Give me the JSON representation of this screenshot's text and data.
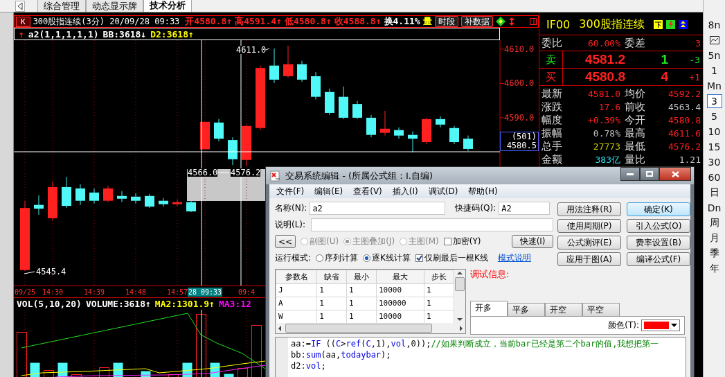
{
  "tabs": [
    {
      "label": "综合管理",
      "selected": false
    },
    {
      "label": "动态显示牌",
      "selected": false
    },
    {
      "label": "技术分析",
      "selected": true
    }
  ],
  "chart": {
    "period_button": "K",
    "title": "300股指连续(3分) 20/09/28 09:33",
    "quotes": [
      {
        "text": "开4580.8↑",
        "color": "#ff2020"
      },
      {
        "text": "高4591.4↑",
        "color": "#ff2020"
      },
      {
        "text": "低4580.8↑",
        "color": "#ff2020"
      },
      {
        "text": "收4588.8↑",
        "color": "#ff2020"
      },
      {
        "text": "换4.11%",
        "color": "#ffffff"
      },
      {
        "text": "量",
        "color": "#ffff00"
      }
    ],
    "buttons": [
      "时段",
      "补数据"
    ],
    "indicator": [
      {
        "text": "↑",
        "color": "#ff2020"
      },
      {
        "text": "a2(1,1,1,1,1)",
        "color": "#ffffff"
      },
      {
        "text": "BB:3618↓",
        "color": "#ffffff"
      },
      {
        "text": "D2:3618↑",
        "color": "#ffff00"
      }
    ],
    "time_axis_marks": [
      {
        "selected": false
      },
      {
        "selected": false
      },
      {
        "selected": false
      },
      {
        "selected": false
      },
      {
        "selected": false
      },
      {
        "selected": true
      },
      {
        "selected": false
      }
    ],
    "chart_data": {
      "type": "candlestick",
      "grid": true,
      "categories": [
        "09/25",
        null,
        "14:30",
        null,
        null,
        "14:39",
        null,
        null,
        "14:48",
        null,
        null,
        "14:57",
        null,
        "28 09:33",
        null,
        null,
        "09:4",
        null,
        null,
        null,
        null,
        null,
        null,
        null,
        null,
        null,
        null,
        null,
        null,
        null,
        null,
        null,
        null
      ],
      "ohlc": [
        [
          4545.6,
          4565.8,
          4545.4,
          4563.7
        ],
        [
          4564.6,
          4567.4,
          4561.7,
          4563.5
        ],
        [
          4560.7,
          4571.4,
          4560.1,
          4569.8
        ],
        [
          4569.8,
          4572.8,
          4563.7,
          4564.3
        ],
        [
          4569.4,
          4570.6,
          4564.6,
          4565.8
        ],
        [
          4568.2,
          4569.4,
          4565.0,
          4565.8
        ],
        [
          4565.8,
          4570.2,
          4565.4,
          4569.4
        ],
        [
          4567.2,
          4568.6,
          4565.4,
          4566.4
        ],
        [
          4567.0,
          4568.0,
          4565.0,
          4565.8
        ],
        [
          4567.2,
          4567.8,
          4563.7,
          4564.1
        ],
        [
          4565.8,
          4566.6,
          4564.1,
          4564.8
        ],
        [
          4564.8,
          4566.2,
          4564.3,
          4565.4
        ],
        [
          4565.4,
          4565.8,
          4562.5,
          4562.7
        ],
        [
          4580.8,
          4588.8,
          4580.8,
          4588.8
        ],
        [
          4588.6,
          4589.6,
          4583.1,
          4583.9
        ],
        [
          4583.5,
          4584.3,
          4576.2,
          4577.9
        ],
        [
          4577.7,
          4588.0,
          4575.9,
          4587.6
        ],
        [
          4587.0,
          4605.2,
          4586.4,
          4604.5
        ],
        [
          4605.2,
          4610.2,
          4600.1,
          4601.1
        ],
        [
          4602.1,
          4611.0,
          4601.7,
          4605.6
        ],
        [
          4605.6,
          4606.6,
          4600.5,
          4601.1
        ],
        [
          4602.1,
          4603.3,
          4595.3,
          4596.1
        ],
        [
          4597.5,
          4598.5,
          4590.8,
          4591.4
        ],
        [
          4596.1,
          4599.1,
          4589.6,
          4590.0
        ],
        [
          4594.0,
          4594.9,
          4589.6,
          4590.0
        ],
        [
          4590.0,
          4590.8,
          4584.3,
          4585.0
        ],
        [
          4585.6,
          4592.0,
          4584.8,
          4586.8
        ],
        [
          4586.4,
          4587.2,
          4583.9,
          4584.8
        ],
        [
          4585.0,
          4586.0,
          4579.9,
          4583.9
        ],
        [
          4582.9,
          4590.0,
          4582.3,
          4589.6
        ],
        [
          4589.6,
          4590.4,
          4587.2,
          4588.0
        ],
        [
          4587.0,
          4587.6,
          4582.3,
          4582.9
        ],
        [
          4583.9,
          4584.8,
          4580.3,
          4580.9
        ]
      ],
      "ylim": [
        4541.1,
        4612.6
      ],
      "yticks": [
        {
          "value": 4590,
          "label": "4590.0"
        },
        {
          "value": 4600,
          "label": "4600.0"
        },
        {
          "value": 4610,
          "label": "4610.0"
        }
      ]
    },
    "cursor_price": {
      "count": "(501)",
      "price": "4580.5"
    },
    "annotations": [
      "4611.0",
      "4566.0",
      "4576.2",
      "4545.4"
    ],
    "volume_legend": [
      {
        "text": "VOL(5,10,20)",
        "color": "#ffffff"
      },
      {
        "text": "VOLUME:3618↑",
        "color": "#ffffff"
      },
      {
        "text": "MA2:1301.9↑",
        "color": "#ffff00"
      },
      {
        "text": "MA3:12",
        "color": "#ff00ff"
      }
    ]
  },
  "quote": {
    "code": "IF00",
    "name": "300股指连续",
    "ratio": [
      {
        "label": "委比",
        "value": "60.00%",
        "color": "#ff2020"
      },
      {
        "label": "委差",
        "value": "3",
        "color": "#ff2020"
      }
    ],
    "orders": [
      {
        "kind": "ask",
        "side": "卖",
        "price": "4581.2",
        "volume": "1",
        "change": "-3"
      },
      {
        "kind": "bid",
        "side": "买",
        "price": "4580.8",
        "volume": "4",
        "change": "+1"
      }
    ],
    "stats": [
      {
        "label": "最新",
        "value": "4581.0",
        "color": "#ff2020"
      },
      {
        "label": "均价",
        "value": "4592.2",
        "color": "#ff2020"
      },
      {
        "label": "涨跌",
        "value": "17.6",
        "color": "#ff2020"
      },
      {
        "label": "前收",
        "value": "4563.4",
        "color": "#c0c0c0"
      },
      {
        "label": "幅度",
        "value": "+0.39%",
        "color": "#ff2020"
      },
      {
        "label": "今开",
        "value": "4580.8",
        "color": "#ff2020"
      },
      {
        "label": "振幅",
        "value": "0.78%",
        "color": "#c0c0c0"
      },
      {
        "label": "最高",
        "value": "4611.6",
        "color": "#ff2020"
      },
      {
        "label": "总手",
        "value": "27773",
        "color": "#c8c800"
      },
      {
        "label": "最低",
        "value": "4576.2",
        "color": "#ff2020"
      },
      {
        "label": "金额",
        "value": "383亿",
        "color": "#30e0f0"
      },
      {
        "label": "量比",
        "value": "1.21",
        "color": "#c0c0c0"
      }
    ]
  },
  "periods": [
    {
      "kind": "text",
      "label": "8n",
      "selected": false
    },
    {
      "kind": "icon",
      "selected": false
    },
    {
      "kind": "text",
      "label": "5n",
      "selected": false
    },
    {
      "kind": "text",
      "label": "1",
      "selected": false
    },
    {
      "kind": "text",
      "label": "Mn",
      "selected": false
    },
    {
      "kind": "text",
      "label": "3",
      "selected": true
    },
    {
      "kind": "text",
      "label": "5",
      "selected": false
    },
    {
      "kind": "text",
      "label": "10",
      "selected": false
    },
    {
      "kind": "text",
      "label": "15",
      "selected": false
    },
    {
      "kind": "text",
      "label": "30",
      "selected": false
    },
    {
      "kind": "text",
      "label": "60",
      "selected": false
    },
    {
      "kind": "text",
      "label": "日",
      "selected": false
    },
    {
      "kind": "text",
      "label": "Dn",
      "selected": false
    },
    {
      "kind": "text",
      "label": "周",
      "selected": false
    },
    {
      "kind": "text",
      "label": "月",
      "selected": false
    },
    {
      "kind": "text",
      "label": "季",
      "selected": false
    },
    {
      "kind": "text",
      "label": "年",
      "selected": false
    }
  ],
  "dialog": {
    "title": "交易系统编辑 - (所属公式组：I.自编)",
    "menu": [
      "文件(F)",
      "编辑(E)",
      "查看(V)",
      "插入(I)",
      "调试(D)",
      "帮助(H)"
    ],
    "name": {
      "label": "名称(N):",
      "value": "a2"
    },
    "shortcut": {
      "label": "快捷码(Q):",
      "value": "A2"
    },
    "description": {
      "label": "说明(L):"
    },
    "collapse_button": "<<",
    "chart_types": [
      {
        "label": "副图(U)",
        "selected": false,
        "disabled": true
      },
      {
        "label": "主图叠加(J)",
        "selected": true,
        "disabled": true
      },
      {
        "label": "主图(M)",
        "selected": false,
        "disabled": true
      }
    ],
    "encrypt": {
      "label": "加密(Y)",
      "checked": false
    },
    "quick_button": "快速(I)",
    "run_mode": {
      "label": "运行模式:",
      "options": [
        {
          "label": "序列计算",
          "selected": false
        },
        {
          "label": "逐K线计算",
          "selected": true
        }
      ]
    },
    "refresh_last": {
      "label": "仅刷最后一根K线",
      "checked": true
    },
    "mode_link": "模式说明",
    "side_buttons": [
      {
        "label": "用法注释(R)",
        "default": false
      },
      {
        "label": "确定(K)",
        "default": true
      },
      {
        "label": "使用周期(P)",
        "default": false
      },
      {
        "label": "引入公式(O)",
        "default": false
      },
      {
        "label": "公式测评(E)",
        "default": false
      },
      {
        "label": "费率设置(B)",
        "default": false
      },
      {
        "label": "应用于图(A)",
        "default": false
      },
      {
        "label": "编译公式(F)",
        "default": false
      }
    ],
    "params": {
      "columns": [
        "参数名",
        "缺省",
        "最小",
        "最大",
        "步长"
      ],
      "rows": [
        [
          "J",
          "1",
          "1",
          "10000",
          "1"
        ],
        [
          "A",
          "1",
          "1",
          "100000",
          "1"
        ],
        [
          "W",
          "1",
          "1",
          "10000",
          "1"
        ]
      ]
    },
    "debug_label": "调试信息:",
    "signal_tabs": [
      {
        "label": "开多",
        "selected": true
      },
      {
        "label": "平多",
        "selected": false
      },
      {
        "label": "开空",
        "selected": false
      },
      {
        "label": "平空",
        "selected": false
      }
    ],
    "color": {
      "label": "颜色(T):",
      "color": "#ff0000"
    },
    "code": [
      [
        {
          "kind": "plain",
          "text": "aa:="
        },
        {
          "kind": "keyword",
          "text": "IF"
        },
        {
          "kind": "plain",
          "text": " (("
        },
        {
          "kind": "keyword",
          "text": "C"
        },
        {
          "kind": "plain",
          "text": ">"
        },
        {
          "kind": "keyword",
          "text": "ref"
        },
        {
          "kind": "plain",
          "text": "("
        },
        {
          "kind": "keyword",
          "text": "C"
        },
        {
          "kind": "plain",
          "text": ",1),"
        },
        {
          "kind": "keyword",
          "text": "vol"
        },
        {
          "kind": "plain",
          "text": ",0));"
        },
        {
          "kind": "comment",
          "text": "//如果判断成立，当前bar已经是第二个bar的值,我想把第一"
        }
      ],
      [
        {
          "kind": "plain",
          "text": "bb:"
        },
        {
          "kind": "keyword",
          "text": "sum"
        },
        {
          "kind": "plain",
          "text": "(aa,"
        },
        {
          "kind": "keyword",
          "text": "todaybar"
        },
        {
          "kind": "plain",
          "text": ");"
        }
      ],
      [
        {
          "kind": "plain",
          "text": "d2:"
        },
        {
          "kind": "keyword",
          "text": "vol"
        },
        {
          "kind": "plain",
          "text": ";"
        }
      ]
    ]
  }
}
